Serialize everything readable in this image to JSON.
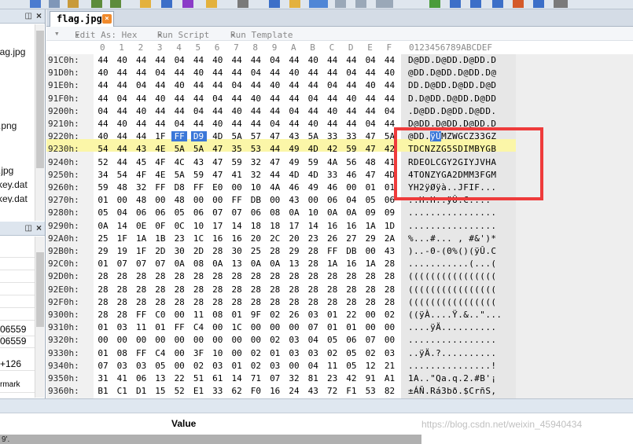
{
  "editor": {
    "tab_label": "flag.jpg",
    "subtoolbar": {
      "edit_as": "Edit As: Hex",
      "run_script": "Run Script",
      "run_template": "Run Template"
    },
    "col_headers": [
      "0",
      "1",
      "2",
      "3",
      "4",
      "5",
      "6",
      "7",
      "8",
      "9",
      "A",
      "B",
      "C",
      "D",
      "E",
      "F"
    ],
    "ascii_header": "0123456789ABCDEF",
    "rows": [
      {
        "addr": "91C0h:",
        "bytes": [
          "44",
          "40",
          "44",
          "44",
          "04",
          "44",
          "40",
          "44",
          "44",
          "04",
          "44",
          "40",
          "44",
          "44",
          "04",
          "44"
        ],
        "ascii": "D@DD.D@DD.D@DD.D"
      },
      {
        "addr": "91D0h:",
        "bytes": [
          "40",
          "44",
          "44",
          "04",
          "44",
          "40",
          "44",
          "44",
          "04",
          "44",
          "40",
          "44",
          "44",
          "04",
          "44",
          "40"
        ],
        "ascii": "@DD.D@DD.D@DD.D@"
      },
      {
        "addr": "91E0h:",
        "bytes": [
          "44",
          "44",
          "04",
          "44",
          "40",
          "44",
          "44",
          "04",
          "44",
          "40",
          "44",
          "44",
          "04",
          "44",
          "40",
          "44"
        ],
        "ascii": "DD.D@DD.D@DD.D@D"
      },
      {
        "addr": "91F0h:",
        "bytes": [
          "44",
          "04",
          "44",
          "40",
          "44",
          "44",
          "04",
          "44",
          "40",
          "44",
          "44",
          "04",
          "44",
          "40",
          "44",
          "44"
        ],
        "ascii": "D.D@DD.D@DD.D@DD"
      },
      {
        "addr": "9200h:",
        "bytes": [
          "04",
          "44",
          "40",
          "44",
          "44",
          "04",
          "44",
          "40",
          "44",
          "44",
          "04",
          "44",
          "40",
          "44",
          "44",
          "04"
        ],
        "ascii": ".D@DD.D@DD.D@DD."
      },
      {
        "addr": "9210h:",
        "bytes": [
          "44",
          "40",
          "44",
          "44",
          "04",
          "44",
          "40",
          "44",
          "44",
          "04",
          "44",
          "40",
          "44",
          "44",
          "04",
          "44"
        ],
        "ascii": "D@DD.D@DD.D@DD.D"
      },
      {
        "addr": "9220h:",
        "bytes": [
          "40",
          "44",
          "44",
          "1F",
          "FF",
          "D9",
          "4D",
          "5A",
          "57",
          "47",
          "43",
          "5A",
          "33",
          "33",
          "47",
          "5A"
        ],
        "ascii": "@DD.ÿÙMZWGCZ33GZ"
      },
      {
        "addr": "9230h:",
        "bytes": [
          "54",
          "44",
          "43",
          "4E",
          "5A",
          "5A",
          "47",
          "35",
          "53",
          "44",
          "49",
          "4D",
          "42",
          "59",
          "47",
          "42"
        ],
        "ascii": "TDCNZZG5SDIMBYGB"
      },
      {
        "addr": "9240h:",
        "bytes": [
          "52",
          "44",
          "45",
          "4F",
          "4C",
          "43",
          "47",
          "59",
          "32",
          "47",
          "49",
          "59",
          "4A",
          "56",
          "48",
          "41"
        ],
        "ascii": "RDEOLCGY2GIYJVHA"
      },
      {
        "addr": "9250h:",
        "bytes": [
          "34",
          "54",
          "4F",
          "4E",
          "5A",
          "59",
          "47",
          "41",
          "32",
          "44",
          "4D",
          "4D",
          "33",
          "46",
          "47",
          "4D"
        ],
        "ascii": "4TONZYGA2DMM3FGM"
      },
      {
        "addr": "9260h:",
        "bytes": [
          "59",
          "48",
          "32",
          "FF",
          "D8",
          "FF",
          "E0",
          "00",
          "10",
          "4A",
          "46",
          "49",
          "46",
          "00",
          "01",
          "01"
        ],
        "ascii": "YH2ÿØÿà..JFIF..."
      },
      {
        "addr": "9270h:",
        "bytes": [
          "01",
          "00",
          "48",
          "00",
          "48",
          "00",
          "00",
          "FF",
          "DB",
          "00",
          "43",
          "00",
          "06",
          "04",
          "05",
          "06"
        ],
        "ascii": "..H.H..ÿÛ.C...."
      },
      {
        "addr": "9280h:",
        "bytes": [
          "05",
          "04",
          "06",
          "06",
          "05",
          "06",
          "07",
          "07",
          "06",
          "08",
          "0A",
          "10",
          "0A",
          "0A",
          "09",
          "09"
        ],
        "ascii": "................"
      },
      {
        "addr": "9290h:",
        "bytes": [
          "0A",
          "14",
          "0E",
          "0F",
          "0C",
          "10",
          "17",
          "14",
          "18",
          "18",
          "17",
          "14",
          "16",
          "16",
          "1A",
          "1D"
        ],
        "ascii": "................"
      },
      {
        "addr": "92A0h:",
        "bytes": [
          "25",
          "1F",
          "1A",
          "1B",
          "23",
          "1C",
          "16",
          "16",
          "20",
          "2C",
          "20",
          "23",
          "26",
          "27",
          "29",
          "2A"
        ],
        "ascii": "%...#... , #&')*"
      },
      {
        "addr": "92B0h:",
        "bytes": [
          "29",
          "19",
          "1F",
          "2D",
          "30",
          "2D",
          "28",
          "30",
          "25",
          "28",
          "29",
          "28",
          "FF",
          "DB",
          "00",
          "43"
        ],
        "ascii": ")..-0-(0%()(ÿÛ.C"
      },
      {
        "addr": "92C0h:",
        "bytes": [
          "01",
          "07",
          "07",
          "07",
          "0A",
          "08",
          "0A",
          "13",
          "0A",
          "0A",
          "13",
          "28",
          "1A",
          "16",
          "1A",
          "28"
        ],
        "ascii": "...........(...("
      },
      {
        "addr": "92D0h:",
        "bytes": [
          "28",
          "28",
          "28",
          "28",
          "28",
          "28",
          "28",
          "28",
          "28",
          "28",
          "28",
          "28",
          "28",
          "28",
          "28",
          "28"
        ],
        "ascii": "(((((((((((((((("
      },
      {
        "addr": "92E0h:",
        "bytes": [
          "28",
          "28",
          "28",
          "28",
          "28",
          "28",
          "28",
          "28",
          "28",
          "28",
          "28",
          "28",
          "28",
          "28",
          "28",
          "28"
        ],
        "ascii": "(((((((((((((((("
      },
      {
        "addr": "92F0h:",
        "bytes": [
          "28",
          "28",
          "28",
          "28",
          "28",
          "28",
          "28",
          "28",
          "28",
          "28",
          "28",
          "28",
          "28",
          "28",
          "28",
          "28"
        ],
        "ascii": "(((((((((((((((("
      },
      {
        "addr": "9300h:",
        "bytes": [
          "28",
          "28",
          "FF",
          "C0",
          "00",
          "11",
          "08",
          "01",
          "9F",
          "02",
          "26",
          "03",
          "01",
          "22",
          "00",
          "02"
        ],
        "ascii": "((ÿÀ....Ÿ.&..\"..."
      },
      {
        "addr": "9310h:",
        "bytes": [
          "01",
          "03",
          "11",
          "01",
          "FF",
          "C4",
          "00",
          "1C",
          "00",
          "00",
          "00",
          "07",
          "01",
          "01",
          "00",
          "00"
        ],
        "ascii": "....ÿÄ.........."
      },
      {
        "addr": "9320h:",
        "bytes": [
          "00",
          "00",
          "00",
          "00",
          "00",
          "00",
          "00",
          "00",
          "00",
          "02",
          "03",
          "04",
          "05",
          "06",
          "07",
          "00"
        ],
        "ascii": "................"
      },
      {
        "addr": "9330h:",
        "bytes": [
          "01",
          "08",
          "FF",
          "C4",
          "00",
          "3F",
          "10",
          "00",
          "02",
          "01",
          "03",
          "03",
          "02",
          "05",
          "02",
          "03"
        ],
        "ascii": "..ÿÄ.?.........."
      },
      {
        "addr": "9340h:",
        "bytes": [
          "07",
          "03",
          "03",
          "05",
          "00",
          "02",
          "03",
          "01",
          "02",
          "03",
          "00",
          "04",
          "11",
          "05",
          "12",
          "21"
        ],
        "ascii": "...............!"
      },
      {
        "addr": "9350h:",
        "bytes": [
          "31",
          "41",
          "06",
          "13",
          "22",
          "51",
          "61",
          "14",
          "71",
          "07",
          "32",
          "81",
          "23",
          "42",
          "91",
          "A1"
        ],
        "ascii": "1A..\"Qa.q.2.#B'¡"
      },
      {
        "addr": "9360h:",
        "bytes": [
          "B1",
          "C1",
          "D1",
          "15",
          "52",
          "E1",
          "33",
          "62",
          "F0",
          "16",
          "24",
          "43",
          "72",
          "F1",
          "53",
          "82"
        ],
        "ascii": "±ÁÑ.Rá3bð.$CrñS‚"
      }
    ]
  },
  "left_panel": {
    "files": [
      {
        "name": "lag.jpg"
      },
      {
        "name": ".png"
      },
      {
        "name": ".jpg"
      },
      {
        "name": "key.dat"
      },
      {
        "name": "key.dat"
      }
    ],
    "inspector_values": [
      "06559",
      "06559",
      "+126",
      "rmark"
    ]
  },
  "bottom": {
    "value_header": "Value",
    "status_fragment": "9'.",
    "watermark": "https://blog.csdn.net/weixin_45940434"
  }
}
